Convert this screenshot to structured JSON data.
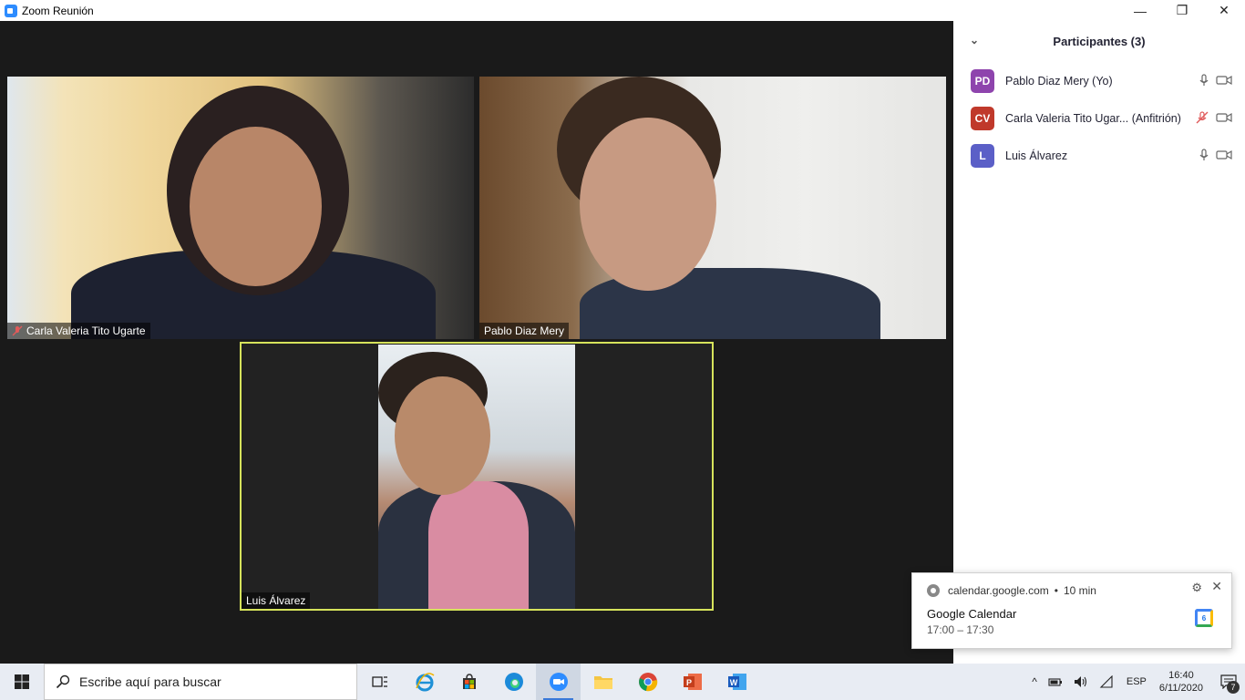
{
  "window": {
    "title": "Zoom Reunión",
    "min": "—",
    "max": "❐",
    "close": "✕"
  },
  "tiles": [
    {
      "name": "Carla Valeria Tito Ugarte",
      "muted": true
    },
    {
      "name": "Pablo Diaz Mery",
      "muted": false
    },
    {
      "name": "Luis Álvarez",
      "muted": false,
      "active_speaker": true
    }
  ],
  "panel": {
    "title": "Participantes (3)",
    "collapse": "⌄",
    "participants": [
      {
        "initials": "PD",
        "name": "Pablo Diaz Mery (Yo)",
        "color": "#8e44ad",
        "mic": "on",
        "video": "off"
      },
      {
        "initials": "CV",
        "name": "Carla Valeria Tito Ugar... (Anfitrión)",
        "color": "#c0392b",
        "mic": "muted",
        "video": "off"
      },
      {
        "initials": "L",
        "name": "Luis Álvarez",
        "color": "#5b5fc7",
        "mic": "on",
        "video": "off"
      }
    ]
  },
  "notification": {
    "source": "calendar.google.com",
    "separator": "•",
    "ago": "10 min",
    "title": "Google Calendar",
    "time": "17:00 – 17:30",
    "gear": "⚙",
    "close": "✕",
    "cal_day": "6"
  },
  "taskbar": {
    "search_placeholder": "Escribe aquí para buscar",
    "apps": [
      "task-view-icon",
      "internet-explorer-icon",
      "store-icon",
      "edge-icon",
      "zoom-icon",
      "file-explorer-icon",
      "chrome-icon",
      "powerpoint-icon",
      "word-icon"
    ],
    "active_app": "zoom-icon",
    "tray": {
      "chevron": "^",
      "lang": "ESP",
      "time": "16:40",
      "date": "6/11/2020",
      "notif_count": "7"
    }
  },
  "colors": {
    "accent": "#2d8cff",
    "speaker_border": "#d6e35b",
    "taskbar": "#e8ecf3"
  }
}
